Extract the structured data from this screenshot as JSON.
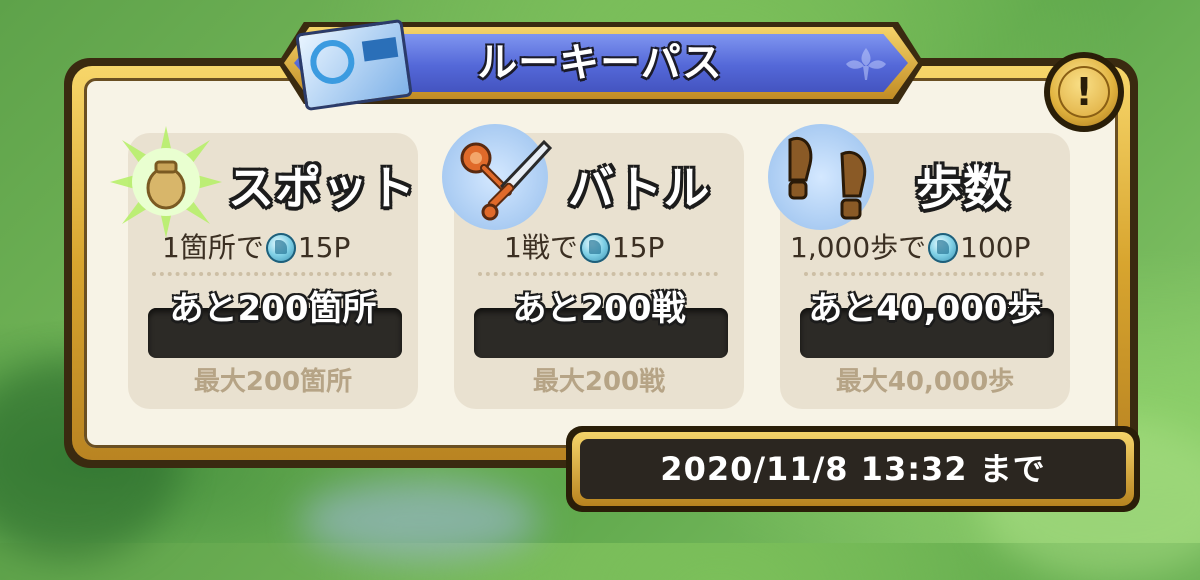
{
  "title": "ルーキーパス",
  "info_button": "!",
  "cards": [
    {
      "name": "スポット",
      "rate_prefix": "1箇所で",
      "rate_points": "15P",
      "remaining": "あと200箇所",
      "max": "最大200箇所",
      "icon": "pot-icon"
    },
    {
      "name": "バトル",
      "rate_prefix": "1戦で",
      "rate_points": "15P",
      "remaining": "あと200戦",
      "max": "最大200戦",
      "icon": "sword-icon"
    },
    {
      "name": "歩数",
      "rate_prefix": "1,000歩で",
      "rate_points": "100P",
      "remaining": "あと40,000歩",
      "max": "最大40,000歩",
      "icon": "footprints-icon"
    }
  ],
  "deadline": "2020/11/8 13:32 まで",
  "colors": {
    "banner_blue": "#5468d8",
    "frame_gold": "#d8a52f",
    "panel_bg": "#f7f3e6",
    "card_bg": "#e9e1d0",
    "max_text": "#b6a486"
  }
}
